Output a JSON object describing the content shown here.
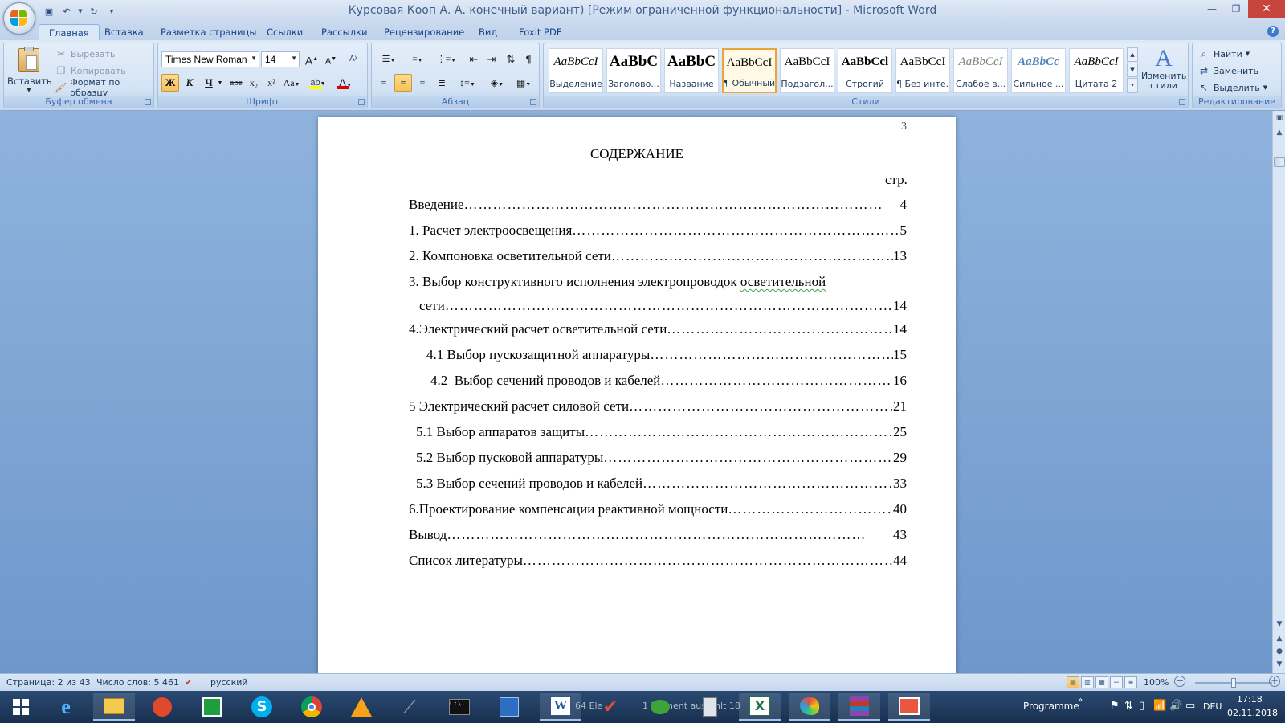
{
  "window": {
    "title": "Курсовая Кооп А. А. конечный вариант) [Режим ограниченной функциональности] - Microsoft Word",
    "controls": [
      "minimize",
      "restore",
      "close"
    ]
  },
  "tabs": [
    "Главная",
    "Вставка",
    "Разметка страницы",
    "Ссылки",
    "Рассылки",
    "Рецензирование",
    "Вид",
    "Foxit PDF"
  ],
  "active_tab": "Главная",
  "ribbon": {
    "clipboard": {
      "label": "Буфер обмена",
      "paste": "Вставить",
      "cut": "Вырезать",
      "copy": "Копировать",
      "format_painter": "Формат по образцу"
    },
    "font": {
      "label": "Шрифт",
      "family": "Times New Roman",
      "size": "14",
      "bold": "Ж",
      "italic": "К",
      "underline": "Ч",
      "strike": "abe",
      "subscript": "x₂",
      "superscript": "x²",
      "change_case": "Aa",
      "grow": "A",
      "shrink": "A"
    },
    "paragraph": {
      "label": "Абзац"
    },
    "styles": {
      "label": "Стили",
      "items": [
        {
          "sample": "AaBbCcI",
          "name": "Выделение"
        },
        {
          "sample": "AaBbC",
          "name": "Заголово..."
        },
        {
          "sample": "AaBbC",
          "name": "Название"
        },
        {
          "sample": "AaBbCcI",
          "name": "¶ Обычный"
        },
        {
          "sample": "AaBbCcI",
          "name": "Подзагол..."
        },
        {
          "sample": "AaBbCcl",
          "name": "Строгий"
        },
        {
          "sample": "AaBbCcI",
          "name": "¶ Без инте..."
        },
        {
          "sample": "AaBbCcI",
          "name": "Слабое в..."
        },
        {
          "sample": "AaBbCc",
          "name": "Сильное ..."
        },
        {
          "sample": "AaBbCcI",
          "name": "Цитата 2"
        }
      ],
      "selected": "¶ Обычный",
      "change_styles": "Изменить стили"
    },
    "editing": {
      "label": "Редактирование",
      "find": "Найти",
      "replace": "Заменить",
      "select": "Выделить"
    }
  },
  "document": {
    "page_number": "3",
    "heading": "СОДЕРЖАНИЕ",
    "page_col_label": "стр.",
    "toc": [
      {
        "text": "Введение",
        "page": "4"
      },
      {
        "text": "1. Расчет электроосвещения",
        "page": "5"
      },
      {
        "text": "2. Компоновка осветительной сети ",
        "page": "13"
      },
      {
        "text": "3. Выбор конструктивного исполнения электропроводок ",
        "text_underlined": "осветительной",
        "continuation": "сети",
        "page": "14"
      },
      {
        "text": "4.Электрический расчет осветительной сети",
        "page": "14"
      },
      {
        "text": "4.1 Выбор пускозащитной аппаратуры ",
        "page": "15"
      },
      {
        "text": "4.2  Выбор сечений проводов и кабелей",
        "page": "16"
      },
      {
        "text": "5 Электрический расчет силовой сети",
        "page": "21"
      },
      {
        "text": "5.1 Выбор аппаратов защиты",
        "page": "25"
      },
      {
        "text": "5.2 Выбор пусковой аппаратуры",
        "page": "29"
      },
      {
        "text": "5.3 Выбор сечений проводов и кабелей",
        "page": "33"
      },
      {
        "text": "6.Проектирование компенсации реактивной мощности",
        "page": "40"
      },
      {
        "text": "Вывод",
        "page": "43"
      },
      {
        "text": "Список литературы",
        "page": "44"
      }
    ]
  },
  "statusbar": {
    "page": "Страница: 2 из 43",
    "words": "Число слов: 5 461",
    "language": "русский",
    "zoom": "100%",
    "zoom_level_fraction": 0.5
  },
  "taskbar": {
    "apps": [
      "start-icon",
      "internet-explorer-icon",
      "file-explorer-icon",
      "foxit-icon",
      "store-icon",
      "skype-icon",
      "chrome-icon",
      "vlc-icon",
      "microphone-icon",
      "cmd-icon",
      "network-tool-icon",
      "word-icon",
      "checkmark-icon",
      "frog-icon",
      "calculator-icon",
      "excel-icon",
      "paint-icon",
      "winrar-icon",
      "presentation-icon"
    ],
    "overlay_text_1": "64 Ele",
    "overlay_text_2": "1 Element aus",
    "overlay_text_3": "hlt 18",
    "programme": "Programme",
    "language": "DEU",
    "time": "17:18",
    "date": "02.11.2018"
  }
}
